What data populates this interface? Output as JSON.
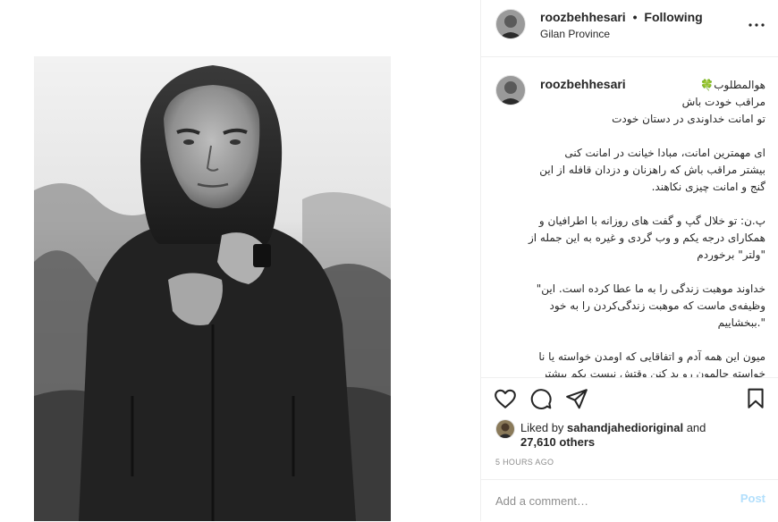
{
  "post": {
    "username": "roozbehhesari",
    "separator": "•",
    "follow_status": "Following",
    "location": "Gilan Province"
  },
  "caption": {
    "username": "roozbehhesari",
    "text": "هوالمطلوب🍀\nمراقب خودت باش\nتو امانت خداوندی در دستان خودت\n\nای مهمترین امانت، مبادا خیانت در امانت کنی\nبیشتر مراقب باش که راهزنان و دزدان قافله از این\nگنج و امانت چیزی نکاهند.\n\nپ.ن: تو خلال گپ و گفت های روزانه با اطرافیان و همکارای درجه یکم و وب گردی و غیره به این جمله از \"ولتر\" برخوردم\n\nخداوند موهبت زندگی را به ما عطا کرده است. این\"\nوظیفه‌ی ماست که موهبت زندگی‌کردن را به خود\n\".ببخشاییم\n\nمیون این همه آدم و اتفاقایی که اومدن خواسته یا نا\nخواسته حالمون رو بد کنن وقتش نیست یکم بیشتر"
  },
  "likes": {
    "prefix": "Liked by",
    "by_user": "sahandjahedioriginal",
    "and": "and",
    "count": "27,610 others"
  },
  "time_ago": "5 HOURS AGO",
  "comment": {
    "placeholder": "Add a comment…",
    "post_label": "Post"
  },
  "icons": {
    "more": "more-horizontal-icon",
    "like": "heart-icon",
    "comment": "comment-icon",
    "share": "paper-plane-icon",
    "save": "bookmark-icon"
  },
  "colors": {
    "text": "#262626",
    "muted": "#8e8e8e",
    "post_disabled": "#b2dffc",
    "border": "#efefef"
  }
}
